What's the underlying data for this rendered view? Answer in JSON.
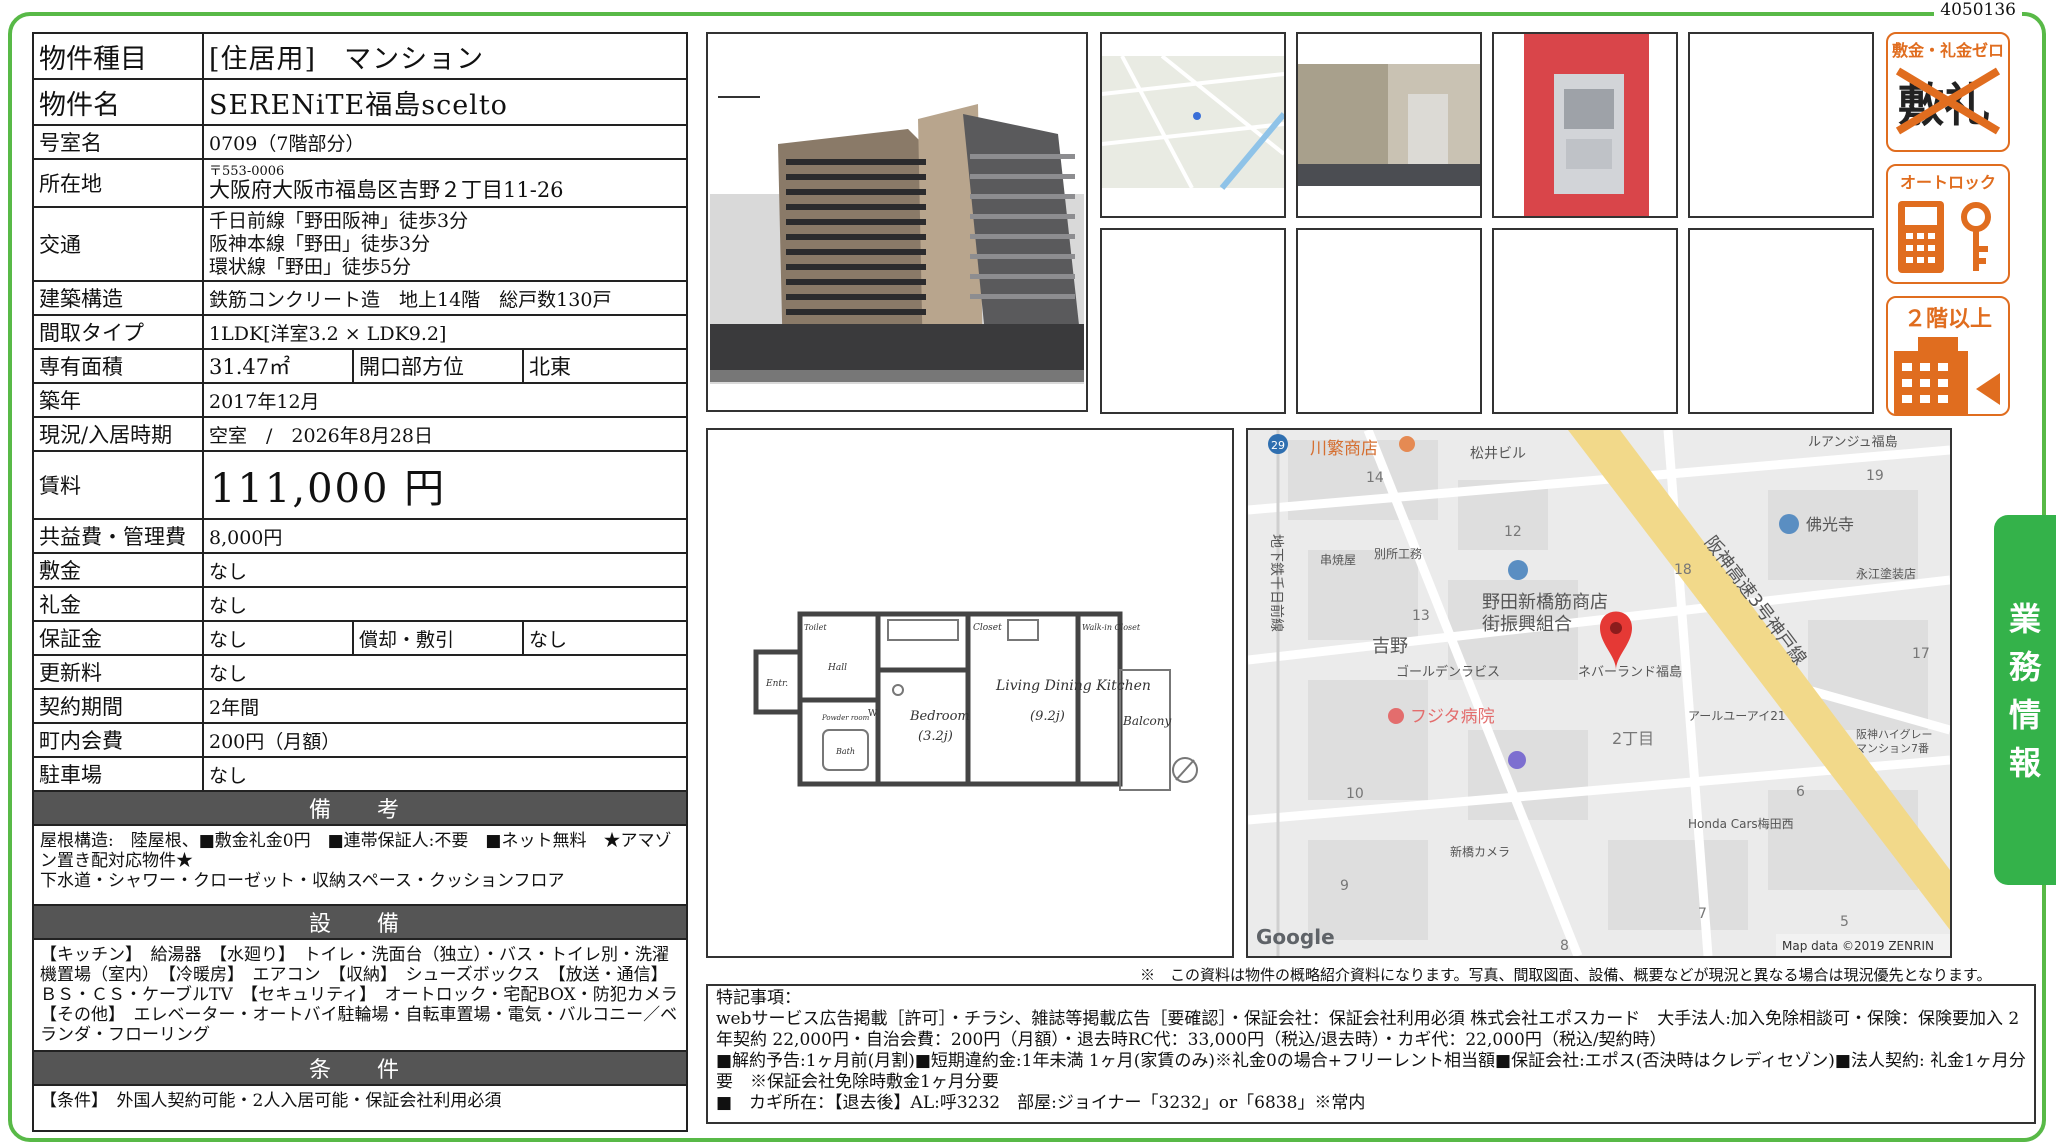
{
  "doc_id": "4050136",
  "spec": {
    "property_type": {
      "label": "物件種目",
      "value": "[住居用]　マンション"
    },
    "property_name": {
      "label": "物件名",
      "value": "SERENiTE福島scelto"
    },
    "room_number": {
      "label": "号室名",
      "value": "0709（7階部分）"
    },
    "address": {
      "label": "所在地",
      "postal": "〒553-0006",
      "value": "大阪府大阪市福島区吉野２丁目11-26"
    },
    "transport": {
      "label": "交通",
      "lines": [
        "千日前線「野田阪神」徒歩3分",
        "阪神本線「野田」徒歩3分",
        "環状線「野田」徒歩5分"
      ]
    },
    "structure": {
      "label": "建築構造",
      "value": "鉄筋コンクリート造　地上14階　総戸数130戸"
    },
    "layout": {
      "label": "間取タイプ",
      "value": "1LDK[洋室3.2 × LDK9.2]"
    },
    "area": {
      "label": "専有面積",
      "value": "31.47㎡",
      "sub_label": "開口部方位",
      "sub_value": "北東"
    },
    "built": {
      "label": "築年",
      "value": "2017年12月"
    },
    "status": {
      "label": "現況/入居時期",
      "value": "空室　/　2026年8月28日"
    },
    "rent": {
      "label": "賃料",
      "value": "111,000 円"
    },
    "common_fee": {
      "label": "共益費・管理費",
      "value": "8,000円"
    },
    "deposit": {
      "label": "敷金",
      "value": "なし"
    },
    "key_money": {
      "label": "礼金",
      "value": "なし"
    },
    "guarantee": {
      "label": "保証金",
      "value": "なし",
      "sub_label": "償却・敷引",
      "sub_value": "なし"
    },
    "renewal": {
      "label": "更新料",
      "value": "なし"
    },
    "contract_period": {
      "label": "契約期間",
      "value": "2年間"
    },
    "town_fee": {
      "label": "町内会費",
      "value": "200円（月額）"
    },
    "parking": {
      "label": "駐車場",
      "value": "なし"
    }
  },
  "remarks": {
    "heading": "備　考",
    "text": "屋根構造:　陸屋根、■敷金礼金0円　■連帯保証人:不要　■ネット無料　★アマゾン置き配対応物件★\n下水道・シャワー・クローゼット・収納スペース・クッションフロア"
  },
  "facilities": {
    "heading": "設　備",
    "text": "【キッチン】　給湯器　【水廻り】　トイレ・洗面台（独立）・バス・トイレ別・洗濯機置場（室内）　【冷暖房】　エアコン　【収納】　シューズボックス　【放送・通信】　ＢＳ・ＣＳ・ケーブルTV　【セキュリティ】　オートロック・宅配BOX・防犯カメラ　【その他】　エレベーター・オートバイ駐輪場・自転車置場・電気・バルコニー／ベランダ・フローリング"
  },
  "conditions": {
    "heading": "条　件",
    "text": "【条件】　外国人契約可能・2人入居可能・保証会社利用必須"
  },
  "badges": [
    {
      "label": "敷金・礼金ゼロ",
      "glyphs": "敷礼",
      "color": "#e06d1f"
    },
    {
      "label": "オートロック",
      "color": "#e06d1f"
    },
    {
      "label": "２階以上",
      "color": "#e06d1f"
    }
  ],
  "floorplan": {
    "rooms": [
      "Living Dining Kitchen",
      "(9.2j)",
      "Bedroom",
      "(3.2j)",
      "Balcony",
      "Walk-in Closet",
      "Closet",
      "Toilet",
      "Hall",
      "Entr.",
      "Powder room",
      "Bath",
      "W"
    ]
  },
  "map": {
    "labels": [
      "川繁商店",
      "松井ビル",
      "ルアンジュ福島",
      "19",
      "14",
      "佛光寺",
      "12",
      "別所工務",
      "串焼屋",
      "永江塗装店",
      "18",
      "阪神高速3号神戸線",
      "野田新橋筋商店",
      "街振興組合",
      "13",
      "吉野",
      "17",
      "ネバーランド福島",
      "ゴールデンラビス",
      "フジタ病院",
      "アールユーアイ21",
      "2丁目",
      "阪神ハイグレー",
      "マンション7番",
      "10",
      "6",
      "Honda Cars梅田西",
      "新橋カメラ",
      "9",
      "7",
      "5",
      "8",
      "地下鉄千日前線",
      "29"
    ],
    "google": "Google",
    "attribution": "Map data ©2019 ZENRIN"
  },
  "note": "※　この資料は物件の概略紹介資料になります。写真、間取図面、設備、概要などが現況と異なる場合は現況優先となります。",
  "special": {
    "heading": "特記事項：",
    "lines": [
      "webサービス広告掲載［許可］・チラシ、雑誌等掲載広告［要確認］・保証会社：保証会社利用必須 株式会社エポスカード　大手法人:加入免除相談可・保険：保険要加入 2年契約 22,000円・自治会費：200円（月額）・退去時RC代：33,000円（税込/退去時）・カギ代：22,000円（税込/契約時）",
      "■解約予告:1ヶ月前(月割)■短期違約金:1年未満 1ヶ月(家賃のみ)※礼金0の場合+フリーレント相当額■保証会社:エポス(否決時はクレディセゾン)■法人契約: 礼金1ヶ月分要　※保証会社免除時敷金1ヶ月分要",
      "■　カギ所在：【退去後】AL:呼3232　部屋:ジョイナー「3232」or「6838」※常内"
    ]
  },
  "side_tab": "業務情報"
}
